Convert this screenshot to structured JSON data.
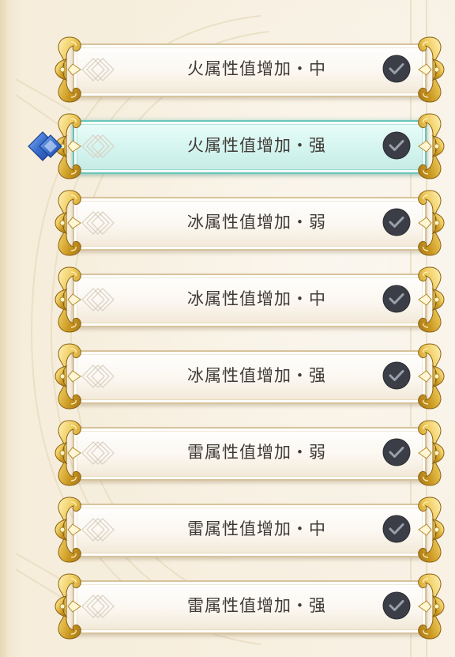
{
  "skill_list": {
    "items": [
      {
        "label": "火属性值增加・中",
        "selected": false,
        "checked": true
      },
      {
        "label": "火属性值增加・强",
        "selected": true,
        "checked": true
      },
      {
        "label": "冰属性值增加・弱",
        "selected": false,
        "checked": true
      },
      {
        "label": "冰属性值增加・中",
        "selected": false,
        "checked": true
      },
      {
        "label": "冰属性值增加・强",
        "selected": false,
        "checked": true
      },
      {
        "label": "雷属性值增加・弱",
        "selected": false,
        "checked": true
      },
      {
        "label": "雷属性值增加・中",
        "selected": false,
        "checked": true
      },
      {
        "label": "雷属性值增加・强",
        "selected": false,
        "checked": true
      }
    ]
  },
  "icons": {
    "check": "check-circle-icon",
    "cursor": "blue-diamond-cursor-icon",
    "ornament": "gold-scroll-ornament"
  },
  "colors": {
    "gold": "#d9b24a",
    "selected_fill": "#d4f4ef",
    "check_bg": "#3b3e46",
    "cursor_blue": "#3a6fd0",
    "text": "#3f3a35"
  }
}
